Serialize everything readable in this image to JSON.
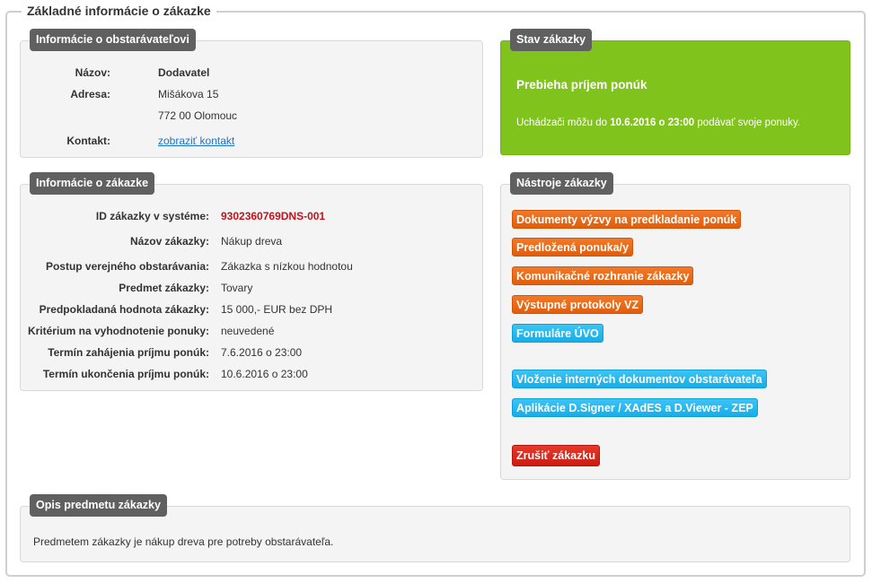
{
  "fieldset": {
    "legend": "Základné informácie o zákazke"
  },
  "contracting": {
    "title": "Informácie o obstarávateľovi",
    "name_label": "Názov:",
    "name_value": "Dodavatel",
    "address_label": "Adresa:",
    "address_line1": "Mišákova 15",
    "address_line2": "772 00 Olomouc",
    "contact_label": "Kontakt:",
    "contact_link": "zobraziť kontakt"
  },
  "status": {
    "title": "Stav zákazky",
    "heading": "Prebieha príjem ponúk",
    "text_before": "Uchádzači môžu do ",
    "deadline": "10.6.2016 o 23:00",
    "text_after": " podávať svoje ponuky."
  },
  "contract": {
    "title": "Informácie o zákazke",
    "rows": [
      {
        "label": "ID zákazky v systéme:",
        "value": "9302360769DNS-001"
      },
      {
        "label": "Názov zákazky:",
        "value": "Nákup dreva"
      },
      {
        "label": "Postup verejného obstarávania:",
        "value": "Zákazka s nízkou hodnotou"
      },
      {
        "label": "Predmet zákazky:",
        "value": "Tovary"
      },
      {
        "label": "Predpokladaná hodnota zákazky:",
        "value": "15 000,- EUR bez DPH"
      },
      {
        "label": "Kritérium na vyhodnotenie ponuky:",
        "value": "neuvedené"
      },
      {
        "label": "Termín zahájenia príjmu ponúk:",
        "value": "7.6.2016 o 23:00"
      },
      {
        "label": "Termín ukončenia príjmu ponúk:",
        "value": "10.6.2016 o 23:00"
      }
    ]
  },
  "tools": {
    "title": "Nástroje zákazky",
    "documents": "Dokumenty výzvy na predkladanie ponúk",
    "submitted": "Predložená ponuka/y",
    "communication": "Komunikačné rozhranie zákazky",
    "protocols": "Výstupné protokoly VZ",
    "forms": "Formuláre ÚVO",
    "internal_docs": "Vloženie interných dokumentov obstarávateľa",
    "apps": "Aplikácie D.Signer / XAdES a D.Viewer - ZEP",
    "cancel": "Zrušiť zákazku"
  },
  "description": {
    "title": "Opis predmetu zákazky",
    "text": "Predmetem zákazky je nákup dreva pre potreby obstarávateľa."
  }
}
